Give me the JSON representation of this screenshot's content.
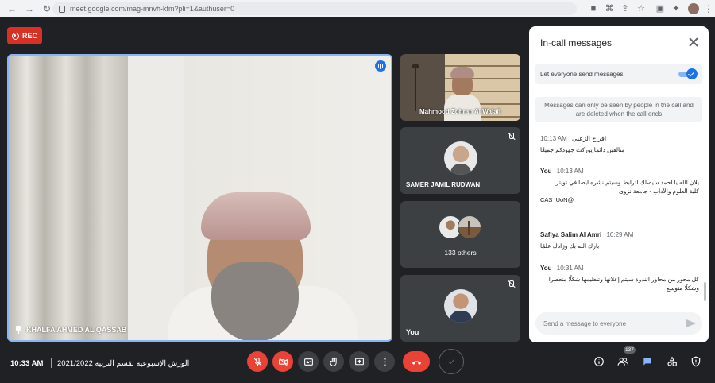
{
  "browser": {
    "url": "meet.google.com/mag-mnvh-kfm?pli=1&authuser=0"
  },
  "recording": {
    "label": "REC"
  },
  "main_participant": {
    "name": "KHALFA AHMED AL QASSAB"
  },
  "tiles": [
    {
      "name": "Mahmood Zohran Al Walali"
    },
    {
      "name": "SAMER JAMIL RUDWAN"
    },
    {
      "name": "133 others"
    },
    {
      "name": "You"
    }
  ],
  "chat": {
    "title": "In-call messages",
    "toggle_label": "Let everyone send messages",
    "notice": "Messages can only be seen by people in the call and are deleted when the call ends",
    "messages": [
      {
        "sender": "افراح الزعبي",
        "time": "10:13 AM",
        "text": "متالقين دائما يوركت جهودكم جميعًا"
      },
      {
        "sender": "You",
        "time": "10:13 AM",
        "text": "يلان الله يا احمد سيصلك الرابط وسيتم نشره ايضا في تويتر ..... كلية العلوم والآداب - جامعة نزوى",
        "text2": "CAS_UoN@"
      },
      {
        "sender": "Safiya Salim Al Amri",
        "time": "10:29 AM",
        "text": "بارك الله بك وزادك علمًا"
      },
      {
        "sender": "You",
        "time": "10:31 AM",
        "text": "كل محور من محاور الندوة سيتم إعلانها وتنظيمها شكلًا متعصرا وشكلًا متوسع"
      }
    ],
    "input_placeholder": "Send a message to everyone"
  },
  "bottom_bar": {
    "time": "10:33 AM",
    "meeting_title": "2021/2022 الورش الإسبوعية لقسم التربية",
    "people_count": "137"
  },
  "colors": {
    "accent": "#1a73e8",
    "danger": "#ea4335",
    "background": "#202124"
  }
}
